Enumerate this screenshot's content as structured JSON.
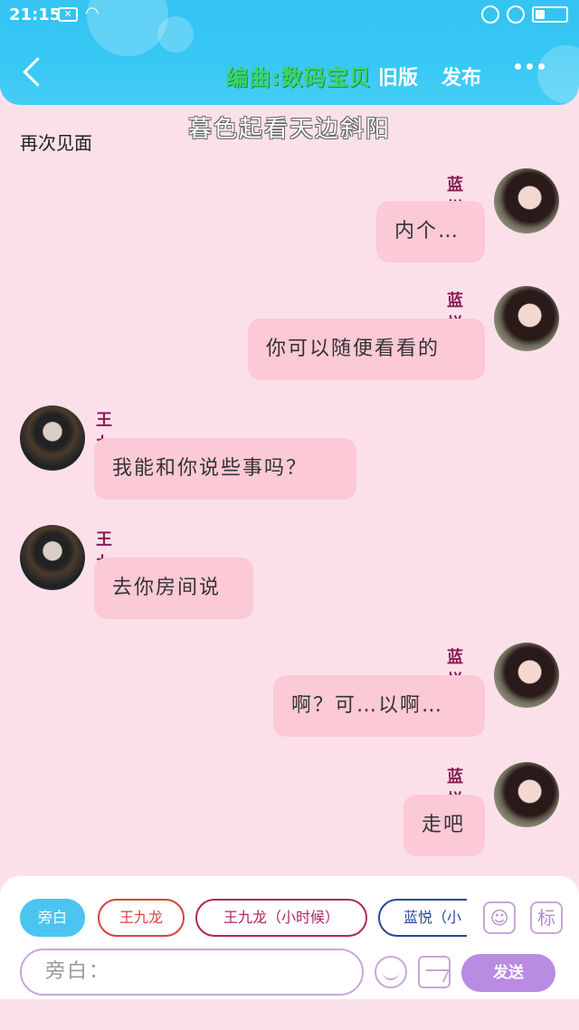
{
  "status_bar": {
    "time": "21:15",
    "notification": "✕"
  },
  "header": {
    "credit": "编曲:数码宝贝",
    "old_version": "旧版",
    "publish": "发布"
  },
  "subtitle": "暮色起看天边斜阳",
  "scene_title": "再次见面",
  "messages": [
    {
      "sender": "蓝悦",
      "text": "内个…"
    },
    {
      "sender": "蓝悦",
      "text": "你可以随便看看的"
    },
    {
      "sender": "王九龙",
      "text": "我能和你说些事吗？"
    },
    {
      "sender": "王九龙",
      "text": "去你房间说"
    },
    {
      "sender": "蓝悦",
      "text": "啊？可…以啊…"
    },
    {
      "sender": "蓝悦",
      "text": "走吧"
    }
  ],
  "roles": [
    {
      "label": "旁白",
      "color": "#4cc4f0"
    },
    {
      "label": "王九龙",
      "color": "#d9423e"
    },
    {
      "label": "王九龙（小时候）",
      "color": "#b0255e"
    },
    {
      "label": "蓝悦（小",
      "color": "#24489c"
    }
  ],
  "tools": {
    "mark_label": "标"
  },
  "input": {
    "placeholder": "旁白："
  },
  "send_label": "发送",
  "colors": {
    "header": "#37c8f4",
    "background": "#fbe0ea",
    "bubble": "#fcc9d6",
    "sender_name": "#8b1a55",
    "send_button": "#b98be3"
  }
}
